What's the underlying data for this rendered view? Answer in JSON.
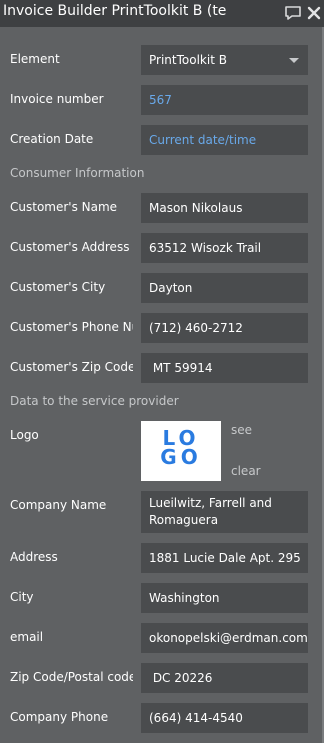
{
  "window": {
    "title": "Invoice Builder PrintToolkit B (te",
    "comment_icon": "comment-icon",
    "close_icon": "close-icon"
  },
  "fields": {
    "element_label": "Element",
    "element_value": "PrintToolkit B",
    "invoice_number_label": "Invoice number",
    "invoice_number_value": "567",
    "creation_date_label": "Creation Date",
    "creation_date_value": "Current date/time"
  },
  "consumer": {
    "heading": "Consumer Information",
    "name_label": "Customer's Name",
    "name_value": "Mason Nikolaus",
    "address_label": "Customer's Address",
    "address_value": "63512 Wisozk Trail",
    "city_label": "Customer's City",
    "city_value": "Dayton",
    "phone_label": "Customer's Phone Nu",
    "phone_value": "(712) 460-2712",
    "zip_label": "Customer's Zip Code/",
    "zip_value": " MT 59914"
  },
  "provider": {
    "heading": "Data to the service provider",
    "logo_label": "Logo",
    "logo_text": "LOGO",
    "see_link": "see",
    "clear_link": "clear",
    "company_name_label": "Company Name",
    "company_name_value": "Lueilwitz, Farrell and Romaguera",
    "address_label": "Address",
    "address_value": "1881 Lucie Dale Apt. 295",
    "city_label": "City",
    "city_value": "Washington",
    "email_label": "email",
    "email_value": "okonopelski@erdman.com",
    "zip_label": "Zip Code/Postal code",
    "zip_value": " DC 20226",
    "phone_label": "Company Phone",
    "phone_value": "(664) 414-4540"
  }
}
